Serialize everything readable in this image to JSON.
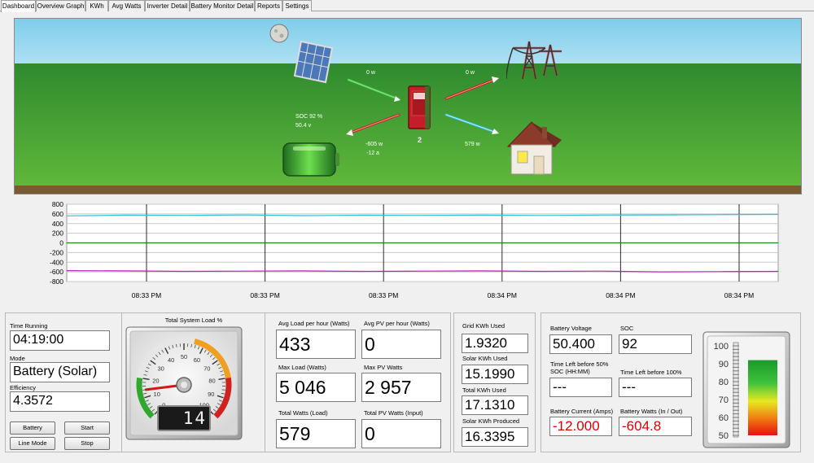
{
  "tabs": [
    {
      "label": "Dashboard",
      "active": true
    },
    {
      "label": "Overview Graph"
    },
    {
      "label": "KWh"
    },
    {
      "label": "Avg Watts"
    },
    {
      "label": "Inverter Detail"
    },
    {
      "label": "Battery Monitor Detail"
    },
    {
      "label": "Reports"
    },
    {
      "label": "Settings"
    }
  ],
  "scene": {
    "soc_text": "SOC 92 %",
    "voltage_text": "50.4 v",
    "pv_watts": "0 w",
    "grid_watts": "0 w",
    "battery_watts": "-605 w",
    "battery_amps": "-12 a",
    "house_watts": "579 w",
    "inverter_number": "2"
  },
  "chart_data": {
    "type": "line",
    "ylim": [
      -800,
      800
    ],
    "yticks": [
      "800",
      "600",
      "400",
      "200",
      "0",
      "-200",
      "-400",
      "-600",
      "-800"
    ],
    "xtick_labels": [
      "08:33 PM",
      "08:33 PM",
      "08:33 PM",
      "08:34 PM",
      "08:34 PM",
      "08:34 PM"
    ],
    "x": [
      0,
      1,
      2,
      3,
      4,
      5,
      6,
      7,
      8,
      9,
      10,
      11,
      12
    ],
    "series": [
      {
        "color": "#30c0d0",
        "values": [
          560,
          575,
          570,
          578,
          565,
          572,
          570,
          574,
          568,
          576,
          580,
          585,
          590
        ]
      },
      {
        "color": "#208020",
        "values": [
          0,
          0,
          0,
          0,
          0,
          0,
          0,
          0,
          0,
          0,
          0,
          0,
          0
        ]
      },
      {
        "color": "#c020c0",
        "values": [
          -575,
          -580,
          -590,
          -585,
          -580,
          -590,
          -585,
          -580,
          -590,
          -585,
          -600,
          -595,
          -590
        ]
      }
    ],
    "grid": true
  },
  "left": {
    "time_running_label": "Time Running",
    "time_running": "04:19:00",
    "mode_label": "Mode",
    "mode": "Battery (Solar)",
    "efficiency_label": "Efficiency",
    "efficiency": "4.3572",
    "battery_btn": "Battery",
    "start_btn": "Start",
    "line_mode_btn": "Line Mode",
    "stop_btn": "Stop"
  },
  "gauge": {
    "title": "Total System Load %",
    "value": 14,
    "display": "14",
    "ticks": [
      "0",
      "10",
      "20",
      "30",
      "40",
      "50",
      "60",
      "70",
      "80",
      "90",
      "100"
    ]
  },
  "loads": {
    "avg_load_label": "Avg Load per hour (Watts)",
    "avg_load": "433",
    "avg_pv_label": "Avg PV per hour (Watts)",
    "avg_pv": "0",
    "max_load_label": "Max Load (Watts)",
    "max_load": "5 046",
    "max_pv_label": "Max PV Watts",
    "max_pv": "2 957",
    "total_load_label": "Total Watts (Load)",
    "total_load": "579",
    "total_pv_label": "Total PV Watts (Input)",
    "total_pv": "0"
  },
  "kwh": {
    "grid_used_label": "Grid KWh Used",
    "grid_used": "1.9320",
    "solar_used_label": "Solar KWh Used",
    "solar_used": "15.1990",
    "total_used_label": "Total KWh Used",
    "total_used": "17.1310",
    "solar_produced_label": "Solar KWh Produced",
    "solar_produced": "16.3395"
  },
  "battery": {
    "voltage_label": "Battery Voltage",
    "voltage": "50.400",
    "soc_label": "SOC",
    "soc": "92",
    "time_left_50_label": "Time Left before 50% SOC (HH:MM)",
    "time_left_50": "---",
    "time_left_100_label": "Time Left before 100%",
    "time_left_100": "---",
    "current_label": "Battery Current (Amps)",
    "current": "-12.000",
    "watts_label": "Battery Watts (In / Out)",
    "watts": "-604.8"
  },
  "meter": {
    "ticks": [
      "100",
      "90",
      "80",
      "70",
      "60",
      "50"
    ],
    "level": 92
  }
}
